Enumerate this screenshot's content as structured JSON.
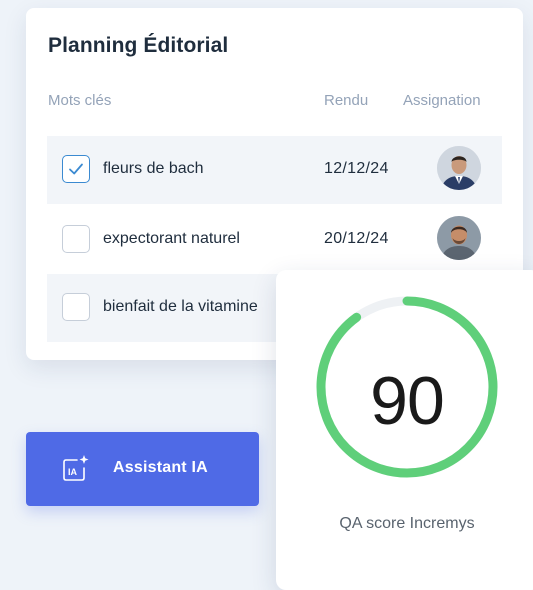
{
  "planning": {
    "title": "Planning Éditorial",
    "columns": {
      "keywords": "Mots clés",
      "rendu": "Rendu",
      "assignation": "Assignation"
    },
    "rows": [
      {
        "keyword": "fleurs de bach",
        "date": "12/12/24",
        "checked": true,
        "avatar": "person-avatar"
      },
      {
        "keyword": "expectorant naturel",
        "date": "20/12/24",
        "checked": false,
        "avatar": "person-avatar"
      },
      {
        "keyword": "bienfait de la vitamine",
        "checked": false
      }
    ]
  },
  "qa": {
    "score": "90",
    "score_fraction": 0.9,
    "label": "QA score Incremys",
    "ring_color": "#5fcf7a"
  },
  "assistant": {
    "label": "Assistant IA",
    "icon": "ai-sparkle-icon",
    "color": "#4f6ae6"
  },
  "colors": {
    "checkbox_accent": "#3b8ad1",
    "background": "#eef3f9"
  }
}
